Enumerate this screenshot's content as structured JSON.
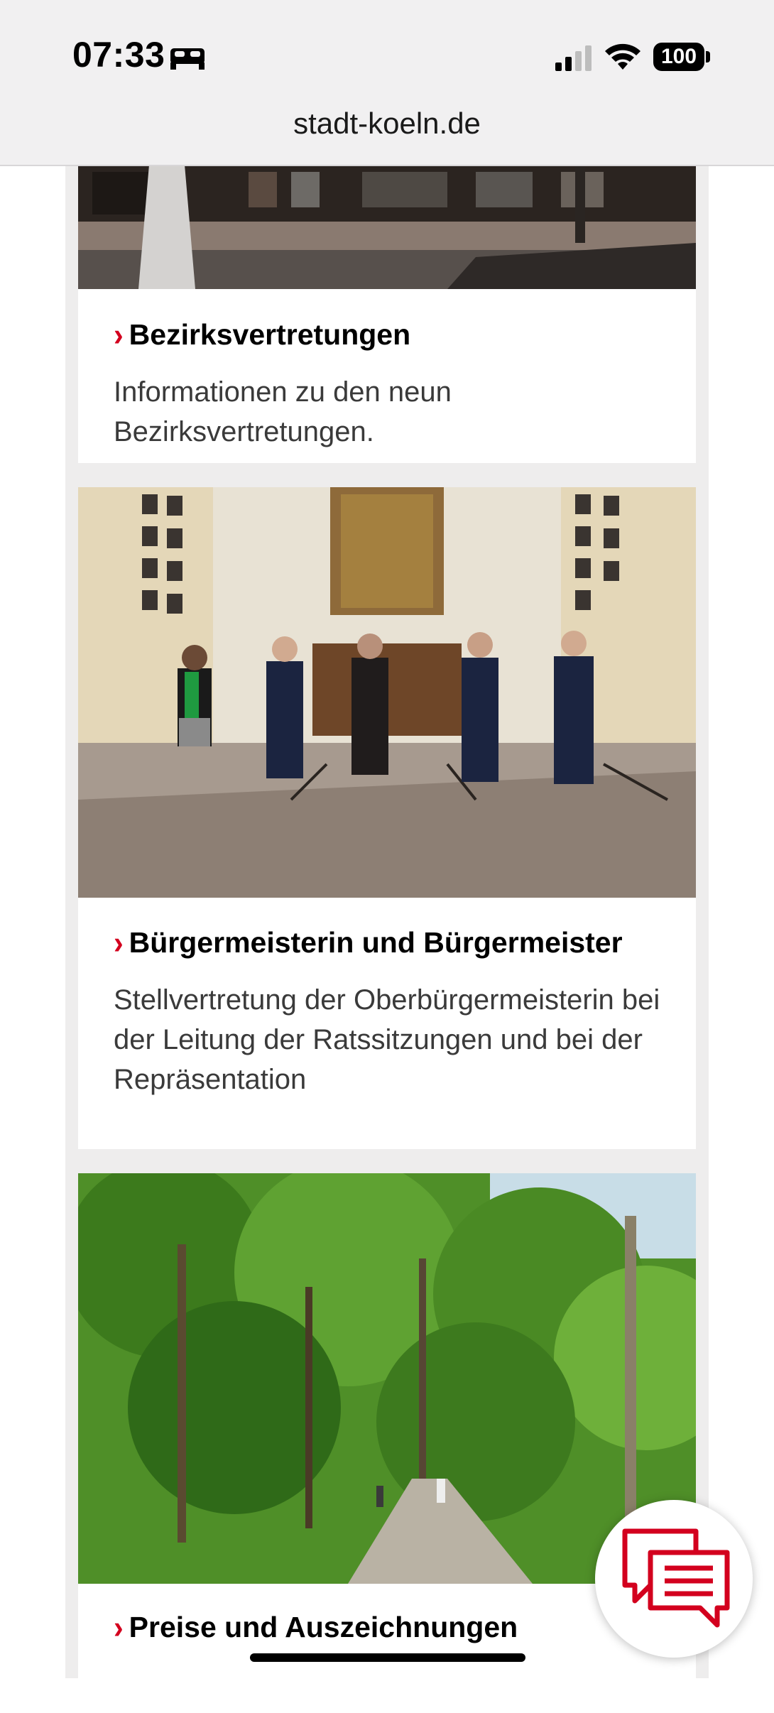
{
  "status_bar": {
    "time": "07:33",
    "battery": "100"
  },
  "browser": {
    "url": "stadt-koeln.de"
  },
  "cards": [
    {
      "title": "Bezirksvertretungen",
      "description": "Informationen zu den neun Bezirksvertretungen.",
      "image": "building-entrance-photo"
    },
    {
      "title": "Bürgermeisterin und Bürgermeister",
      "description": "Stellvertretung der Oberbürgermeisterin bei der Leitung der Ratssitzungen und bei der Repräsentation",
      "image": "council-hall-group-photo"
    },
    {
      "title": "Preise und Auszeichnungen",
      "description": "",
      "image": "forest-path-photo"
    }
  ],
  "chevron": "›",
  "icons": [
    "sleep-icon",
    "cellular-signal-icon",
    "wifi-icon",
    "battery-icon",
    "chat-icon"
  ],
  "colors": {
    "accent": "#d3001e",
    "background": "#eeeded"
  }
}
